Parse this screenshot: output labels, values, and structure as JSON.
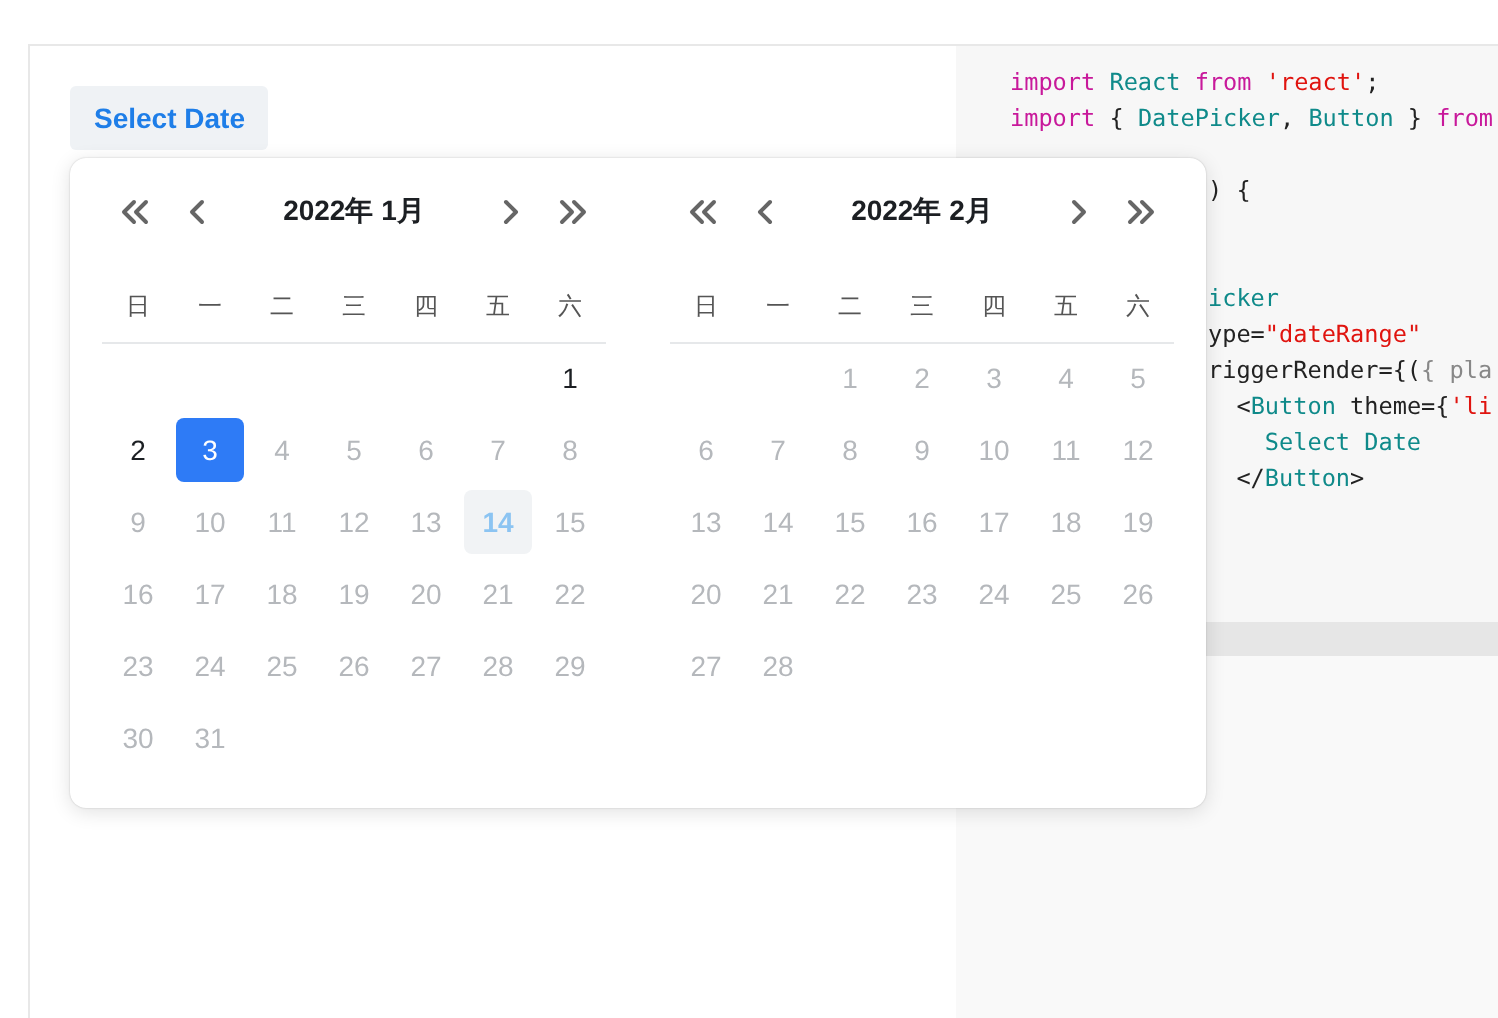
{
  "trigger_button": {
    "label": "Select Date"
  },
  "calendar": {
    "months": [
      {
        "title": "2022年 1月",
        "weekdays": [
          "日",
          "一",
          "二",
          "三",
          "四",
          "五",
          "六"
        ],
        "days": [
          {
            "kind": "empty"
          },
          {
            "kind": "empty"
          },
          {
            "kind": "empty"
          },
          {
            "kind": "empty"
          },
          {
            "kind": "empty"
          },
          {
            "kind": "empty"
          },
          {
            "kind": "day",
            "text": "1",
            "selected": false,
            "disabled": false,
            "today": false
          },
          {
            "kind": "day",
            "text": "2",
            "selected": false,
            "disabled": false,
            "today": false
          },
          {
            "kind": "day",
            "text": "3",
            "selected": true,
            "disabled": false,
            "today": false
          },
          {
            "kind": "day",
            "text": "4",
            "selected": false,
            "disabled": true,
            "today": false
          },
          {
            "kind": "day",
            "text": "5",
            "selected": false,
            "disabled": true,
            "today": false
          },
          {
            "kind": "day",
            "text": "6",
            "selected": false,
            "disabled": true,
            "today": false
          },
          {
            "kind": "day",
            "text": "7",
            "selected": false,
            "disabled": true,
            "today": false
          },
          {
            "kind": "day",
            "text": "8",
            "selected": false,
            "disabled": true,
            "today": false
          },
          {
            "kind": "day",
            "text": "9",
            "selected": false,
            "disabled": true,
            "today": false
          },
          {
            "kind": "day",
            "text": "10",
            "selected": false,
            "disabled": true,
            "today": false
          },
          {
            "kind": "day",
            "text": "11",
            "selected": false,
            "disabled": true,
            "today": false
          },
          {
            "kind": "day",
            "text": "12",
            "selected": false,
            "disabled": true,
            "today": false
          },
          {
            "kind": "day",
            "text": "13",
            "selected": false,
            "disabled": true,
            "today": false
          },
          {
            "kind": "day",
            "text": "14",
            "selected": false,
            "disabled": true,
            "today": true
          },
          {
            "kind": "day",
            "text": "15",
            "selected": false,
            "disabled": true,
            "today": false
          },
          {
            "kind": "day",
            "text": "16",
            "selected": false,
            "disabled": true,
            "today": false
          },
          {
            "kind": "day",
            "text": "17",
            "selected": false,
            "disabled": true,
            "today": false
          },
          {
            "kind": "day",
            "text": "18",
            "selected": false,
            "disabled": true,
            "today": false
          },
          {
            "kind": "day",
            "text": "19",
            "selected": false,
            "disabled": true,
            "today": false
          },
          {
            "kind": "day",
            "text": "20",
            "selected": false,
            "disabled": true,
            "today": false
          },
          {
            "kind": "day",
            "text": "21",
            "selected": false,
            "disabled": true,
            "today": false
          },
          {
            "kind": "day",
            "text": "22",
            "selected": false,
            "disabled": true,
            "today": false
          },
          {
            "kind": "day",
            "text": "23",
            "selected": false,
            "disabled": true,
            "today": false
          },
          {
            "kind": "day",
            "text": "24",
            "selected": false,
            "disabled": true,
            "today": false
          },
          {
            "kind": "day",
            "text": "25",
            "selected": false,
            "disabled": true,
            "today": false
          },
          {
            "kind": "day",
            "text": "26",
            "selected": false,
            "disabled": true,
            "today": false
          },
          {
            "kind": "day",
            "text": "27",
            "selected": false,
            "disabled": true,
            "today": false
          },
          {
            "kind": "day",
            "text": "28",
            "selected": false,
            "disabled": true,
            "today": false
          },
          {
            "kind": "day",
            "text": "29",
            "selected": false,
            "disabled": true,
            "today": false
          },
          {
            "kind": "day",
            "text": "30",
            "selected": false,
            "disabled": true,
            "today": false
          },
          {
            "kind": "day",
            "text": "31",
            "selected": false,
            "disabled": true,
            "today": false
          }
        ]
      },
      {
        "title": "2022年 2月",
        "weekdays": [
          "日",
          "一",
          "二",
          "三",
          "四",
          "五",
          "六"
        ],
        "days": [
          {
            "kind": "empty"
          },
          {
            "kind": "empty"
          },
          {
            "kind": "day",
            "text": "1",
            "selected": false,
            "disabled": true,
            "today": false
          },
          {
            "kind": "day",
            "text": "2",
            "selected": false,
            "disabled": true,
            "today": false
          },
          {
            "kind": "day",
            "text": "3",
            "selected": false,
            "disabled": true,
            "today": false
          },
          {
            "kind": "day",
            "text": "4",
            "selected": false,
            "disabled": true,
            "today": false
          },
          {
            "kind": "day",
            "text": "5",
            "selected": false,
            "disabled": true,
            "today": false
          },
          {
            "kind": "day",
            "text": "6",
            "selected": false,
            "disabled": true,
            "today": false
          },
          {
            "kind": "day",
            "text": "7",
            "selected": false,
            "disabled": true,
            "today": false
          },
          {
            "kind": "day",
            "text": "8",
            "selected": false,
            "disabled": true,
            "today": false
          },
          {
            "kind": "day",
            "text": "9",
            "selected": false,
            "disabled": true,
            "today": false
          },
          {
            "kind": "day",
            "text": "10",
            "selected": false,
            "disabled": true,
            "today": false
          },
          {
            "kind": "day",
            "text": "11",
            "selected": false,
            "disabled": true,
            "today": false
          },
          {
            "kind": "day",
            "text": "12",
            "selected": false,
            "disabled": true,
            "today": false
          },
          {
            "kind": "day",
            "text": "13",
            "selected": false,
            "disabled": true,
            "today": false
          },
          {
            "kind": "day",
            "text": "14",
            "selected": false,
            "disabled": true,
            "today": false
          },
          {
            "kind": "day",
            "text": "15",
            "selected": false,
            "disabled": true,
            "today": false
          },
          {
            "kind": "day",
            "text": "16",
            "selected": false,
            "disabled": true,
            "today": false
          },
          {
            "kind": "day",
            "text": "17",
            "selected": false,
            "disabled": true,
            "today": false
          },
          {
            "kind": "day",
            "text": "18",
            "selected": false,
            "disabled": true,
            "today": false
          },
          {
            "kind": "day",
            "text": "19",
            "selected": false,
            "disabled": true,
            "today": false
          },
          {
            "kind": "day",
            "text": "20",
            "selected": false,
            "disabled": true,
            "today": false
          },
          {
            "kind": "day",
            "text": "21",
            "selected": false,
            "disabled": true,
            "today": false
          },
          {
            "kind": "day",
            "text": "22",
            "selected": false,
            "disabled": true,
            "today": false
          },
          {
            "kind": "day",
            "text": "23",
            "selected": false,
            "disabled": true,
            "today": false
          },
          {
            "kind": "day",
            "text": "24",
            "selected": false,
            "disabled": true,
            "today": false
          },
          {
            "kind": "day",
            "text": "25",
            "selected": false,
            "disabled": true,
            "today": false
          },
          {
            "kind": "day",
            "text": "26",
            "selected": false,
            "disabled": true,
            "today": false
          },
          {
            "kind": "day",
            "text": "27",
            "selected": false,
            "disabled": true,
            "today": false
          },
          {
            "kind": "day",
            "text": "28",
            "selected": false,
            "disabled": true,
            "today": false
          }
        ]
      }
    ]
  },
  "code": {
    "lines": [
      {
        "kind": "code",
        "tokens": [
          {
            "kind": "keyword",
            "text": "import "
          },
          {
            "kind": "name",
            "text": "React "
          },
          {
            "kind": "keyword",
            "text": "from "
          },
          {
            "kind": "string",
            "text": "'react'"
          },
          {
            "kind": "plain",
            "text": ";"
          }
        ]
      },
      {
        "kind": "code",
        "tokens": [
          {
            "kind": "keyword",
            "text": "import "
          },
          {
            "kind": "plain",
            "text": "{ "
          },
          {
            "kind": "name",
            "text": "DatePicker"
          },
          {
            "kind": "plain",
            "text": ", "
          },
          {
            "kind": "name",
            "text": "Button"
          },
          {
            "kind": "plain",
            "text": " } "
          },
          {
            "kind": "keyword",
            "text": "from"
          }
        ]
      },
      {
        "kind": "hidden"
      },
      {
        "kind": "clipped",
        "tokens": [
          {
            "kind": "plain",
            "text": ") {"
          }
        ]
      },
      {
        "kind": "hidden"
      },
      {
        "kind": "hidden"
      },
      {
        "kind": "clipped",
        "tokens": [
          {
            "kind": "name",
            "text": "icker"
          }
        ]
      },
      {
        "kind": "clipped",
        "tokens": [
          {
            "kind": "plain",
            "text": "ype="
          },
          {
            "kind": "string",
            "text": "\"dateRange\""
          }
        ]
      },
      {
        "kind": "clipped",
        "tokens": [
          {
            "kind": "plain",
            "text": "riggerRender={("
          },
          {
            "kind": "muted",
            "text": "{ pla"
          }
        ]
      },
      {
        "kind": "clipped",
        "tokens": [
          {
            "kind": "plain",
            "text": "  <"
          },
          {
            "kind": "name",
            "text": "Button"
          },
          {
            "kind": "plain",
            "text": " theme={"
          },
          {
            "kind": "string",
            "text": "'li"
          }
        ]
      },
      {
        "kind": "clipped",
        "tokens": [
          {
            "kind": "name",
            "text": "    Select Date"
          }
        ]
      },
      {
        "kind": "clipped",
        "tokens": [
          {
            "kind": "plain",
            "text": "  </"
          },
          {
            "kind": "name",
            "text": "Button"
          },
          {
            "kind": "plain",
            "text": ">"
          }
        ]
      }
    ]
  }
}
